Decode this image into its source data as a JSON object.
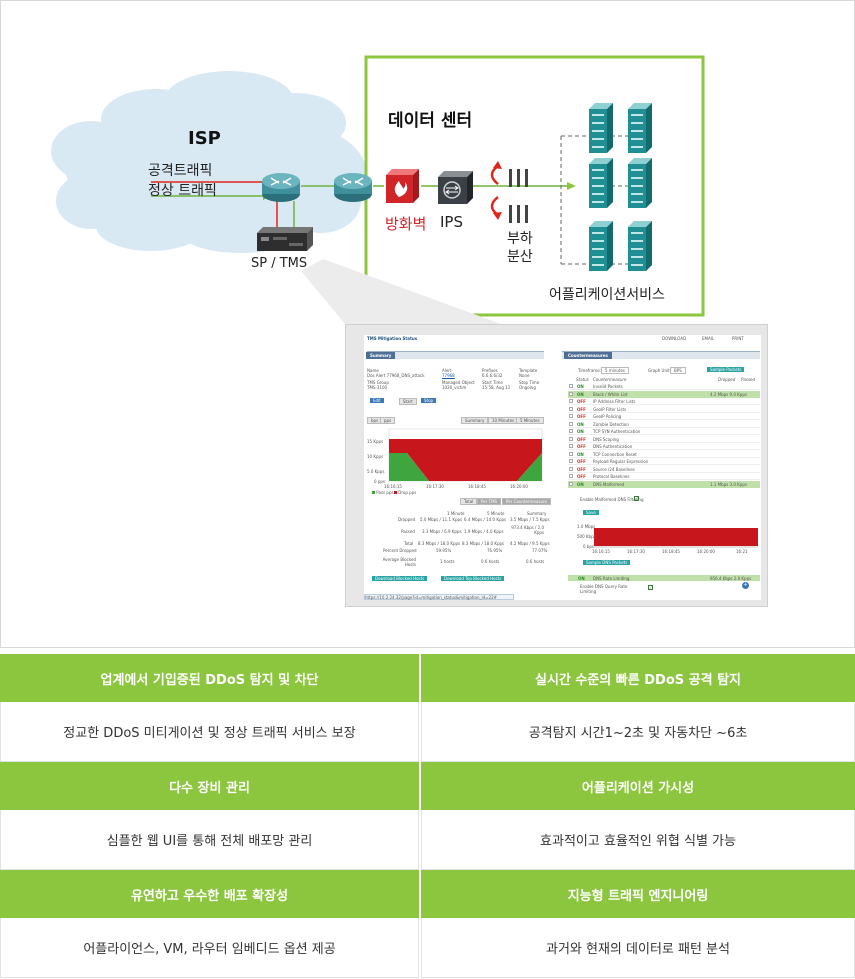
{
  "diagram": {
    "isp_label": "ISP",
    "attack_traffic": "공격트래픽",
    "normal_traffic": "정상 트래픽",
    "sp_tms": "SP / TMS",
    "datacenter": "데이터 센터",
    "firewall": "방화벽",
    "ips": "IPS",
    "lb_line1": "부하",
    "lb_line2": "분산",
    "app_service": "어플리케이션서비스",
    "colors": {
      "frame_green": "#8cc63f",
      "attack_red": "#e1251b",
      "normal_green": "#6db33f",
      "firewall_red": "#d0262a",
      "cloud": "#d9e9f3",
      "router": "#3f8f9c",
      "server": "#1f8f93"
    }
  },
  "dashboard": {
    "page_title": "TMS Mitigation Status",
    "download": "DOWNLOAD",
    "email": "EMAIL",
    "print": "PRINT",
    "summary_tab": "Summary",
    "summary": {
      "name_label": "Name",
      "name_value": "Dos Alert 77968_DNS_attack",
      "alert_label": "Alert",
      "alert_value": "77968",
      "prefixes_label": "Prefixes",
      "prefixes_value": "6.6.6.6/32",
      "template_label": "Template",
      "template_value": "None",
      "group_label": "TMS Group",
      "group_value": "TMS-3100",
      "managed_label": "Managed Object",
      "managed_value": "1020_victim",
      "start_label": "Start Time",
      "start_value": "15:58, Aug 11",
      "stop_label": "Stop Time",
      "stop_value": "Ongoing",
      "edit": "Edit",
      "start": "Start",
      "stop": "Stop"
    },
    "graph": {
      "tab_bps": "bps",
      "tab_pps": "pps",
      "summary": "Summary",
      "ten_min": "10 Minutes",
      "five_min": "5 Minutes",
      "y_labels": [
        "15 Kpps",
        "10 Kpps",
        "5.0 Kpps",
        "0 pps"
      ],
      "x_labels": [
        "16:16:15",
        "16:17:30",
        "16:18:45",
        "16:20:00"
      ],
      "legend_pass": "Pass pps",
      "legend_drop": "Drop pps",
      "tab_total": "Total",
      "tab_perms": "Per TMS",
      "tab_percm": "Per Countermeasure"
    },
    "stats": {
      "headers": [
        "1 Minute",
        "5 Minute",
        "Summary"
      ],
      "dropped_label": "Dropped",
      "dropped": [
        "5.0 Mbps / 11.1 Kpps",
        "6.4 Mbps / 14.0 Kpps",
        "3.5 Mbps / 7.5 Kpps"
      ],
      "passed_label": "Passed",
      "passed": [
        "3.3 Mbps / 6.9 Kpps",
        "1.9 Mbps / 4.0 Kpps",
        "973.4 Kbps / 2.0 Kpps"
      ],
      "total_label": "Total",
      "total": [
        "8.3 Mbps / 18.0 Kpps",
        "8.3 Mbps / 18.0 Kpps",
        "4.2 Mbps / 9.5 Kpps"
      ],
      "percent_label": "Percent Dropped",
      "percent": [
        "59.95%",
        "76.95%",
        "77.07%"
      ],
      "hosts_label": "Average Blocked Hosts",
      "hosts": [
        "1 hosts",
        "0.6 hosts",
        "0.6 hosts"
      ],
      "dl_blocked": "Download Blocked Hosts",
      "dl_top": "Download Top Blocked Hosts"
    },
    "countermeasures_tab": "Countermeasures",
    "timeframe_label": "Timeframe:",
    "timeframe_value": "5 minutes",
    "graph_unit_label": "Graph Unit:",
    "graph_unit_value": "BPS",
    "sample_packets": "Sample Packets",
    "cm_col_status": "Status",
    "cm_col_name": "Countermeasure",
    "cm_col_dropped": "Dropped",
    "cm_col_passed": "Passed",
    "cm_rows": [
      {
        "state": "ON",
        "name": "Invalid Packets",
        "value": ""
      },
      {
        "state": "ON",
        "name": "Black / White List",
        "value": "4.2 Mbps 9.0 Kpps"
      },
      {
        "state": "OFF",
        "name": "IP Address Filter Lists",
        "value": ""
      },
      {
        "state": "OFF",
        "name": "GeoIP Filter Lists",
        "value": ""
      },
      {
        "state": "OFF",
        "name": "GeoIP Policing",
        "value": ""
      },
      {
        "state": "ON",
        "name": "Zombie Detection",
        "value": ""
      },
      {
        "state": "ON",
        "name": "TCP SYN Authentication",
        "value": ""
      },
      {
        "state": "OFF",
        "name": "DNS Scoping",
        "value": ""
      },
      {
        "state": "OFF",
        "name": "DNS Authentication",
        "value": ""
      },
      {
        "state": "ON",
        "name": "TCP Connection Reset",
        "value": ""
      },
      {
        "state": "OFF",
        "name": "Payload Regular Expression",
        "value": ""
      },
      {
        "state": "OFF",
        "name": "Source /24 Baselines",
        "value": ""
      },
      {
        "state": "OFF",
        "name": "Protocol Baselines",
        "value": ""
      },
      {
        "state": "ON",
        "name": "DNS Malformed",
        "value": "1.1 Mbps 3.0 Kpps"
      }
    ],
    "enable_malformed": "Enable Malformed DNS Filtering",
    "save": "Save",
    "mini_y": [
      "1.0 Mbps",
      "500 Kbps",
      "0 bps"
    ],
    "mini_x": [
      "16:16:15",
      "16:17:30",
      "16:18:45",
      "16:20:00",
      "16:21"
    ],
    "sample_dns": "Sample DNS Packets",
    "dns_rate_state": "ON",
    "dns_rate": "DNS Rate Limiting",
    "dns_rate_value": "956.4 Kbps 2.0 Kpps",
    "enable_query": "Enable DNS Query Rate Limiting",
    "status_url": "https://10.2.24.32/page?id=mitigation_status&mitigation_id=22#"
  },
  "features": {
    "left": [
      {
        "title": "업계에서 기입증된 DDoS 탐지 및 차단",
        "desc": "정교한 DDoS 미티게이션 및 정상 트래픽 서비스 보장"
      },
      {
        "title": "다수 장비 관리",
        "desc": "심플한 웹 UI를 통해 전체 배포망 관리"
      },
      {
        "title": "유연하고 우수한 배포 확장성",
        "desc": "어플라이언스, VM, 라우터 임베디드 옵션 제공"
      }
    ],
    "right": [
      {
        "title": "실시간 수준의 빠른 DDoS 공격 탐지",
        "desc": "공격탐지 시간1~2초 및 자동차단 ~6초"
      },
      {
        "title": "어플리케이션 가시성",
        "desc": "효과적이고 효율적인 위협 식별 가능"
      },
      {
        "title": "지능형 트래픽 엔지니어링",
        "desc": "과거와 현재의 데이터로 패턴 분석"
      }
    ]
  }
}
